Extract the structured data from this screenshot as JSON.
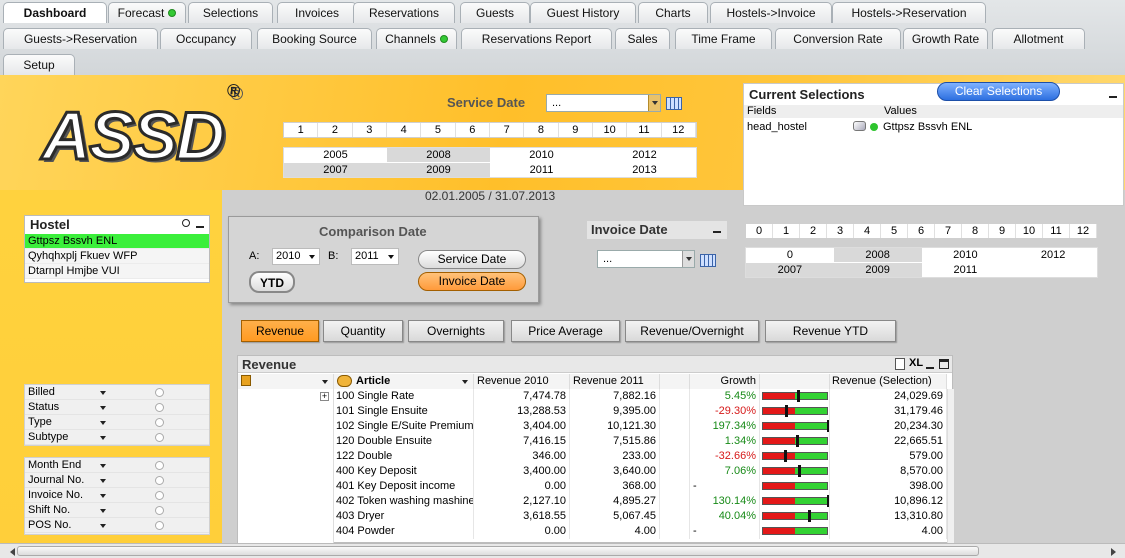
{
  "tabs_row1": [
    {
      "label": "Dashboard",
      "active": true
    },
    {
      "label": "Forecast",
      "dot": true
    },
    {
      "label": "Selections"
    },
    {
      "label": "Invoices"
    },
    {
      "label": "Reservations"
    },
    {
      "label": "Guests"
    },
    {
      "label": "Guest History"
    },
    {
      "label": "Charts"
    },
    {
      "label": "Hostels->Invoice"
    },
    {
      "label": "Hostels->Reservation"
    }
  ],
  "tabs_row2": [
    {
      "label": "Guests->Reservation"
    },
    {
      "label": "Occupancy"
    },
    {
      "label": "Booking Source"
    },
    {
      "label": "Channels",
      "dot": true
    },
    {
      "label": "Reservations Report"
    },
    {
      "label": "Sales"
    },
    {
      "label": "Time Frame"
    },
    {
      "label": "Conversion Rate"
    },
    {
      "label": "Growth Rate"
    },
    {
      "label": "Allotment"
    }
  ],
  "tabs_row3": [
    {
      "label": "Setup"
    }
  ],
  "logo": "ASSD",
  "logo_mark": "®",
  "service_date": {
    "label": "Service Date",
    "value": "...",
    "months": [
      "1",
      "2",
      "3",
      "4",
      "5",
      "6",
      "7",
      "8",
      "9",
      "10",
      "11",
      "12"
    ],
    "years_top": [
      "2005",
      "2008",
      "2010",
      "2012"
    ],
    "years_bottom": [
      "2007",
      "2009",
      "2011",
      "2013"
    ],
    "range": "02.01.2005 / 31.07.2013"
  },
  "current_selections": {
    "title": "Current Selections",
    "clear_label": "Clear Selections",
    "col_fields": "Fields",
    "col_values": "Values",
    "row_field": "head_hostel",
    "row_value": "Gttpsz Bssvh ENL"
  },
  "hostel": {
    "title": "Hostel",
    "items": [
      "Gttpsz Bssvh ENL",
      "Qyhqhxplj Fkuev WFP",
      "Dtarnpl Hmjbe VUI"
    ]
  },
  "filters1": [
    "Billed",
    "Status",
    "Type",
    "Subtype"
  ],
  "filters2": [
    "Month End",
    "Journal No.",
    "Invoice No.",
    "Shift No.",
    "POS No."
  ],
  "comparison": {
    "title": "Comparison Date",
    "a_label": "A:",
    "a_value": "2010",
    "b_label": "B:",
    "b_value": "2011",
    "ytd": "YTD",
    "service_btn": "Service Date",
    "invoice_btn": "Invoice Date"
  },
  "invoice_date": {
    "label": "Invoice Date",
    "value": "...",
    "months": [
      "0",
      "1",
      "2",
      "3",
      "4",
      "5",
      "6",
      "7",
      "8",
      "9",
      "10",
      "11",
      "12"
    ],
    "years_top": [
      "0",
      "2008",
      "2010",
      "2012"
    ],
    "years_bottom": [
      "2007",
      "2009",
      "2011",
      ""
    ]
  },
  "metric_buttons": [
    "Revenue",
    "Quantity",
    "Overnights",
    "Price Average",
    "Revenue/Overnight",
    "Revenue YTD"
  ],
  "revenue": {
    "title": "Revenue",
    "tool_xl": "XL",
    "headers": {
      "article": "Article",
      "rev2010": "Revenue 2010",
      "rev2011": "Revenue 2011",
      "growth": "Growth",
      "sel": "Revenue (Selection)"
    },
    "rows": [
      {
        "article": "100 Single Rate",
        "r2010": "7,474.78",
        "r2011": "7,882.16",
        "growth": "5.45%",
        "gtype": "pos",
        "sel": "24,029.69",
        "gauge": 0.53
      },
      {
        "article": "101 Single Ensuite",
        "r2010": "13,288.53",
        "r2011": "9,395.00",
        "growth": "-29.30%",
        "gtype": "neg",
        "sel": "31,179.46",
        "gauge": 0.35
      },
      {
        "article": "102 Single E/Suite Premium",
        "r2010": "3,404.00",
        "r2011": "10,121.30",
        "growth": "197.34%",
        "gtype": "pos",
        "sel": "20,234.30",
        "gauge": 0.98
      },
      {
        "article": "120 Double Ensuite",
        "r2010": "7,416.15",
        "r2011": "7,515.86",
        "growth": "1.34%",
        "gtype": "pos",
        "sel": "22,665.51",
        "gauge": 0.51
      },
      {
        "article": "122 Double",
        "r2010": "346.00",
        "r2011": "233.00",
        "growth": "-32.66%",
        "gtype": "neg",
        "sel": "579.00",
        "gauge": 0.34
      },
      {
        "article": "400 Key Deposit",
        "r2010": "3,400.00",
        "r2011": "3,640.00",
        "growth": "7.06%",
        "gtype": "pos",
        "sel": "8,570.00",
        "gauge": 0.54
      },
      {
        "article": "401 Key Deposit income",
        "r2010": "0.00",
        "r2011": "368.00",
        "growth": "-",
        "gtype": "none",
        "sel": "398.00",
        "gauge": null
      },
      {
        "article": "402 Token washing mashine",
        "r2010": "2,127.10",
        "r2011": "4,895.27",
        "growth": "130.14%",
        "gtype": "pos",
        "sel": "10,896.12",
        "gauge": 0.98
      },
      {
        "article": "403 Dryer",
        "r2010": "3,618.55",
        "r2011": "5,067.45",
        "growth": "40.04%",
        "gtype": "pos",
        "sel": "13,310.80",
        "gauge": 0.7
      },
      {
        "article": "404 Powder",
        "r2010": "0.00",
        "r2011": "4.00",
        "growth": "-",
        "gtype": "none",
        "sel": "4.00",
        "gauge": null
      }
    ]
  },
  "colors": {
    "accent_orange": "#ff9a22",
    "selected_green": "#3bef3b",
    "positive": "#178a17",
    "negative": "#d61a1a"
  }
}
